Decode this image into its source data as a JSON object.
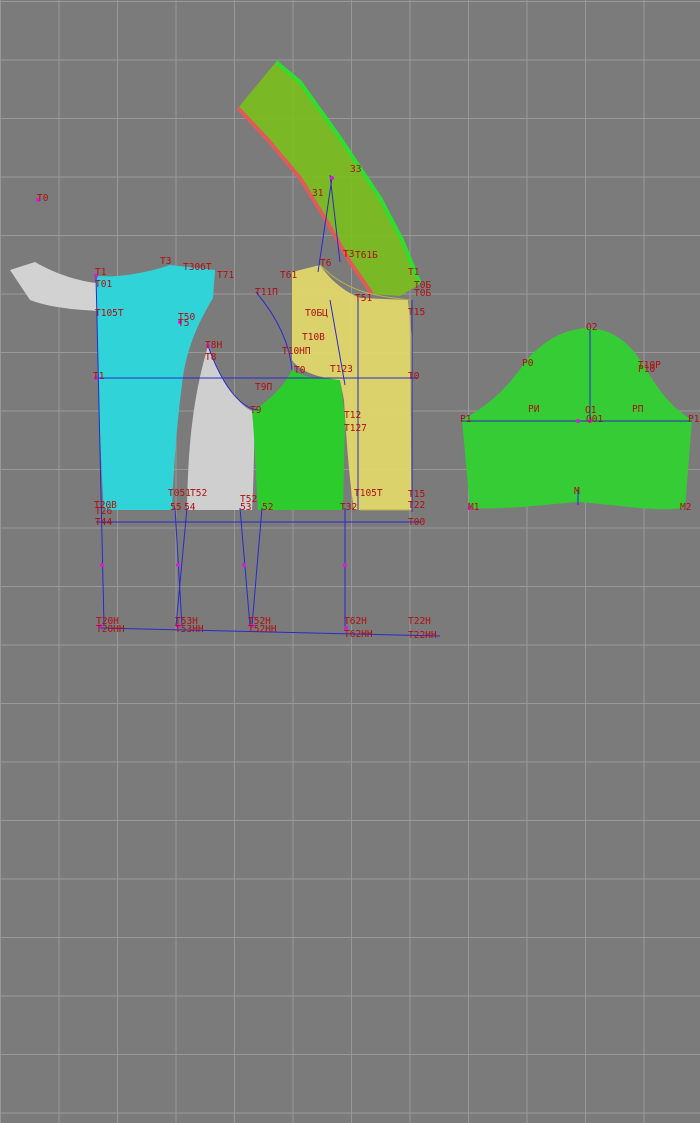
{
  "canvas": {
    "name": "pattern-workspace"
  },
  "colors": {
    "background": "#7b7b7b",
    "grid": "#989898",
    "back_piece": "#2fd3d8",
    "side_piece": "#c9c9c9",
    "front_piece": "#2ecc2e",
    "front_overlay": "#e8dc6a",
    "collar_fill": "#7bbf1c",
    "collar_edge": "#e05a5a",
    "sleeve": "#35cc35",
    "construction_line": "#2a2acc",
    "label_text": "#b01010",
    "point_marker": "#d020d0"
  },
  "labels": {
    "t0": "T0",
    "t1": "T1",
    "t01": "T01",
    "t3": "T3",
    "t3ok": "T30бТ",
    "t71": "T71",
    "t105t": "T105Т",
    "t50": "T50",
    "t5": "T5",
    "t8": "T8",
    "t8n": "T8Н",
    "t1l": "T1",
    "t9p": "T9П",
    "t9": "T9",
    "t11p": "T11П",
    "t10np": "T10НП",
    "t10v": "T10В",
    "t0p": "T0",
    "t23": "T123",
    "t14": "T12",
    "t27": "T127",
    "t31": "31",
    "t33": "33",
    "t3top": "T3",
    "t61": "T61",
    "t6": "T6",
    "t61b": "T61Б",
    "t51": "T51",
    "t15": "T15",
    "t15b": "T15",
    "tpb": "T0Б",
    "tpv": "T0Б",
    "t1r": "T1",
    "tdbc": "T0БЦ",
    "t51t": "T051",
    "t52": "T52",
    "t55": "55",
    "t54": "54",
    "t53": "53",
    "t52b": "52",
    "t105": "T105Т",
    "t20b": "T20В",
    "t26": "T26",
    "tdd": "T44",
    "t00": "T00",
    "t32": "T32",
    "t22": "T22",
    "t20n": "T20Н",
    "t20nn": "T20НН",
    "t53n": "T53Н",
    "t53nn": "T53НН",
    "t52n": "T52Н",
    "t52nn": "T52НН",
    "t62n": "T62Н",
    "t62nn": "T62НН",
    "t22n": "T22Н",
    "t22nn": "T22НН",
    "o2": "O2",
    "r0": "P0",
    "r0p": "T10Р",
    "r0e": "P10",
    "r1": "P1",
    "ri": "PИ",
    "o1": "O1",
    "o01": "O01",
    "rp": "PП",
    "r1r": "P1",
    "m": "M",
    "m1": "M1",
    "m2": "M2"
  }
}
